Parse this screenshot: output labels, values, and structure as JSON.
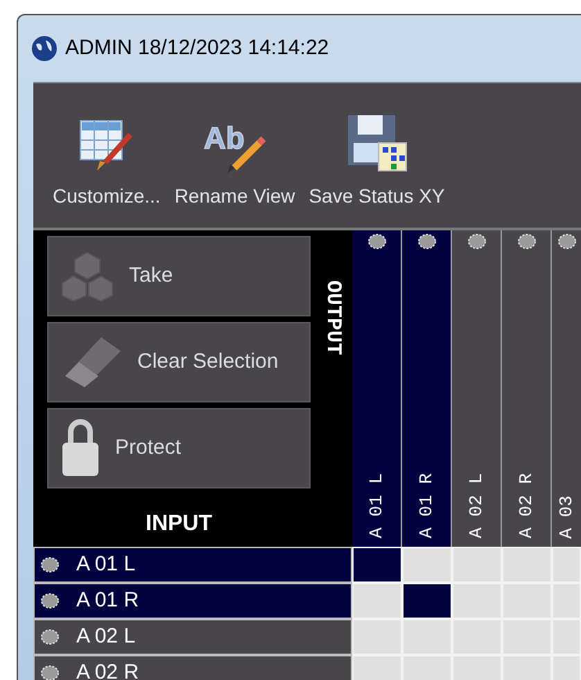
{
  "window": {
    "title": "ADMIN 18/12/2023 14:14:22"
  },
  "toolbar": [
    {
      "label": "Customize...",
      "kind": "customize"
    },
    {
      "label": "Rename View",
      "kind": "rename",
      "icon_text": "Ab"
    },
    {
      "label": "Save Status XY",
      "kind": "save"
    }
  ],
  "actions": [
    {
      "label": "Take",
      "kind": "take"
    },
    {
      "label": "Clear Selection",
      "kind": "clear"
    },
    {
      "label": "Protect",
      "kind": "protect"
    }
  ],
  "output_label": "OUTPUT",
  "input_label": "INPUT",
  "outputs": [
    {
      "label": "A 01 L",
      "selected": true
    },
    {
      "label": "A 01 R",
      "selected": true
    },
    {
      "label": "A 02 L",
      "selected": false
    },
    {
      "label": "A 02 R",
      "selected": false
    },
    {
      "label": "A 03",
      "selected": false
    }
  ],
  "inputs": [
    {
      "label": "A 01 L",
      "selected": true,
      "cells": [
        {
          "connected": true
        },
        {
          "connected": false
        },
        {
          "connected": false
        },
        {
          "connected": false
        },
        {
          "connected": false
        }
      ]
    },
    {
      "label": "A 01 R",
      "selected": true,
      "cells": [
        {
          "connected": false
        },
        {
          "connected": true
        },
        {
          "connected": false
        },
        {
          "connected": false
        },
        {
          "connected": false
        }
      ]
    },
    {
      "label": "A 02 L",
      "selected": false,
      "cells": [
        {
          "connected": false
        },
        {
          "connected": false
        },
        {
          "connected": false
        },
        {
          "connected": false
        },
        {
          "connected": false
        }
      ]
    },
    {
      "label": "A 02 R",
      "selected": false,
      "cells": [
        {
          "connected": false
        },
        {
          "connected": false
        },
        {
          "connected": false
        },
        {
          "connected": false
        },
        {
          "connected": false
        }
      ]
    }
  ]
}
